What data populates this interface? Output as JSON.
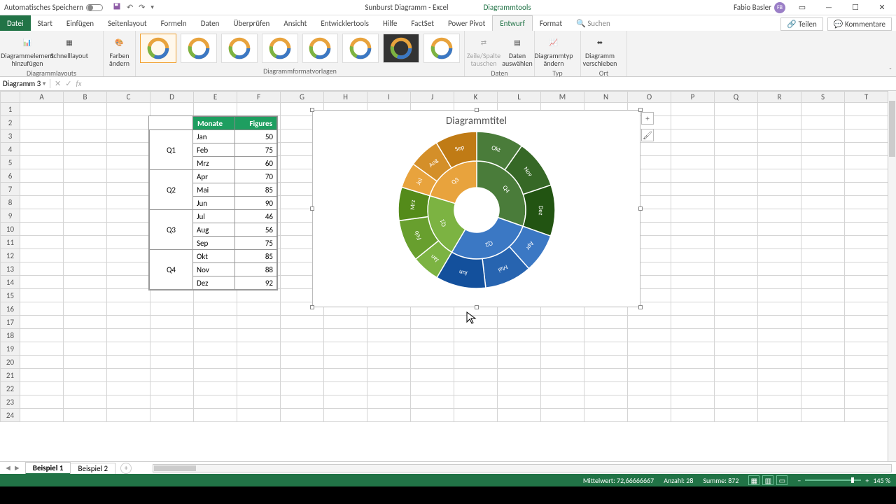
{
  "titlebar": {
    "autosave": "Automatisches Speichern",
    "doc": "Sunburst Diagramm  -  Excel",
    "tools": "Diagrammtools",
    "user": "Fabio Basler",
    "initials": "FB"
  },
  "tabs": {
    "file": "Datei",
    "start": "Start",
    "insert": "Einfügen",
    "layout": "Seitenlayout",
    "formulas": "Formeln",
    "data": "Daten",
    "review": "Überprüfen",
    "view": "Ansicht",
    "dev": "Entwicklertools",
    "help": "Hilfe",
    "factset": "FactSet",
    "pivot": "Power Pivot",
    "design": "Entwurf",
    "format": "Format",
    "search_ic": "🔍",
    "search": "Suchen",
    "share": "Teilen",
    "comments": "Kommentare"
  },
  "ribbon": {
    "addelem": "Diagrammelement\nhinzufügen",
    "quick": "Schnelllayout",
    "colors": "Farben\nändern",
    "g1": "Diagrammlayouts",
    "g2": "Diagrammformatvorlagen",
    "g3": "Daten",
    "g4": "Typ",
    "g5": "Ort",
    "swap": "Zeile/Spalte\ntauschen",
    "select": "Daten\nauswählen",
    "type": "Diagrammtyp\nändern",
    "move": "Diagramm\nverschieben"
  },
  "namebox": "Diagramm 3",
  "cols": [
    "A",
    "B",
    "C",
    "D",
    "E",
    "F",
    "G",
    "H",
    "I",
    "J",
    "K",
    "L",
    "M",
    "N",
    "O",
    "P",
    "Q",
    "R",
    "S",
    "T"
  ],
  "rowcount": 24,
  "table": {
    "h1": "Monate",
    "h2": "Figures",
    "groups": [
      "Q1",
      "Q2",
      "Q3",
      "Q4"
    ],
    "rows": [
      [
        "Jan",
        "50"
      ],
      [
        "Feb",
        "75"
      ],
      [
        "Mrz",
        "60"
      ],
      [
        "Apr",
        "70"
      ],
      [
        "Mai",
        "85"
      ],
      [
        "Jun",
        "90"
      ],
      [
        "Jul",
        "46"
      ],
      [
        "Aug",
        "56"
      ],
      [
        "Sep",
        "75"
      ],
      [
        "Okt",
        "85"
      ],
      [
        "Nov",
        "88"
      ],
      [
        "Dez",
        "92"
      ]
    ]
  },
  "chart": {
    "title": "Diagrammtitel"
  },
  "chart_data": {
    "type": "sunburst",
    "title": "Diagrammtitel",
    "hierarchy": [
      {
        "name": "Q1",
        "color": "#7cb342",
        "children": [
          {
            "name": "Jan",
            "value": 50
          },
          {
            "name": "Feb",
            "value": 75
          },
          {
            "name": "Mrz",
            "value": 60
          }
        ]
      },
      {
        "name": "Q2",
        "color": "#3b78c4",
        "children": [
          {
            "name": "Apr",
            "value": 70
          },
          {
            "name": "Mai",
            "value": 85
          },
          {
            "name": "Jun",
            "value": 90
          }
        ]
      },
      {
        "name": "Q3",
        "color": "#e8a33d",
        "children": [
          {
            "name": "Jul",
            "value": 46
          },
          {
            "name": "Aug",
            "value": 56
          },
          {
            "name": "Sep",
            "value": 75
          }
        ]
      },
      {
        "name": "Q4",
        "color": "#4a7c3a",
        "children": [
          {
            "name": "Okt",
            "value": 85
          },
          {
            "name": "Nov",
            "value": 88
          },
          {
            "name": "Dez",
            "value": 92
          }
        ]
      }
    ]
  },
  "sheets": {
    "s1": "Beispiel 1",
    "s2": "Beispiel 2"
  },
  "status": {
    "avg": "Mittelwert: 72,66666667",
    "count": "Anzahl: 28",
    "sum": "Summe: 872",
    "zoom": "145 %"
  }
}
